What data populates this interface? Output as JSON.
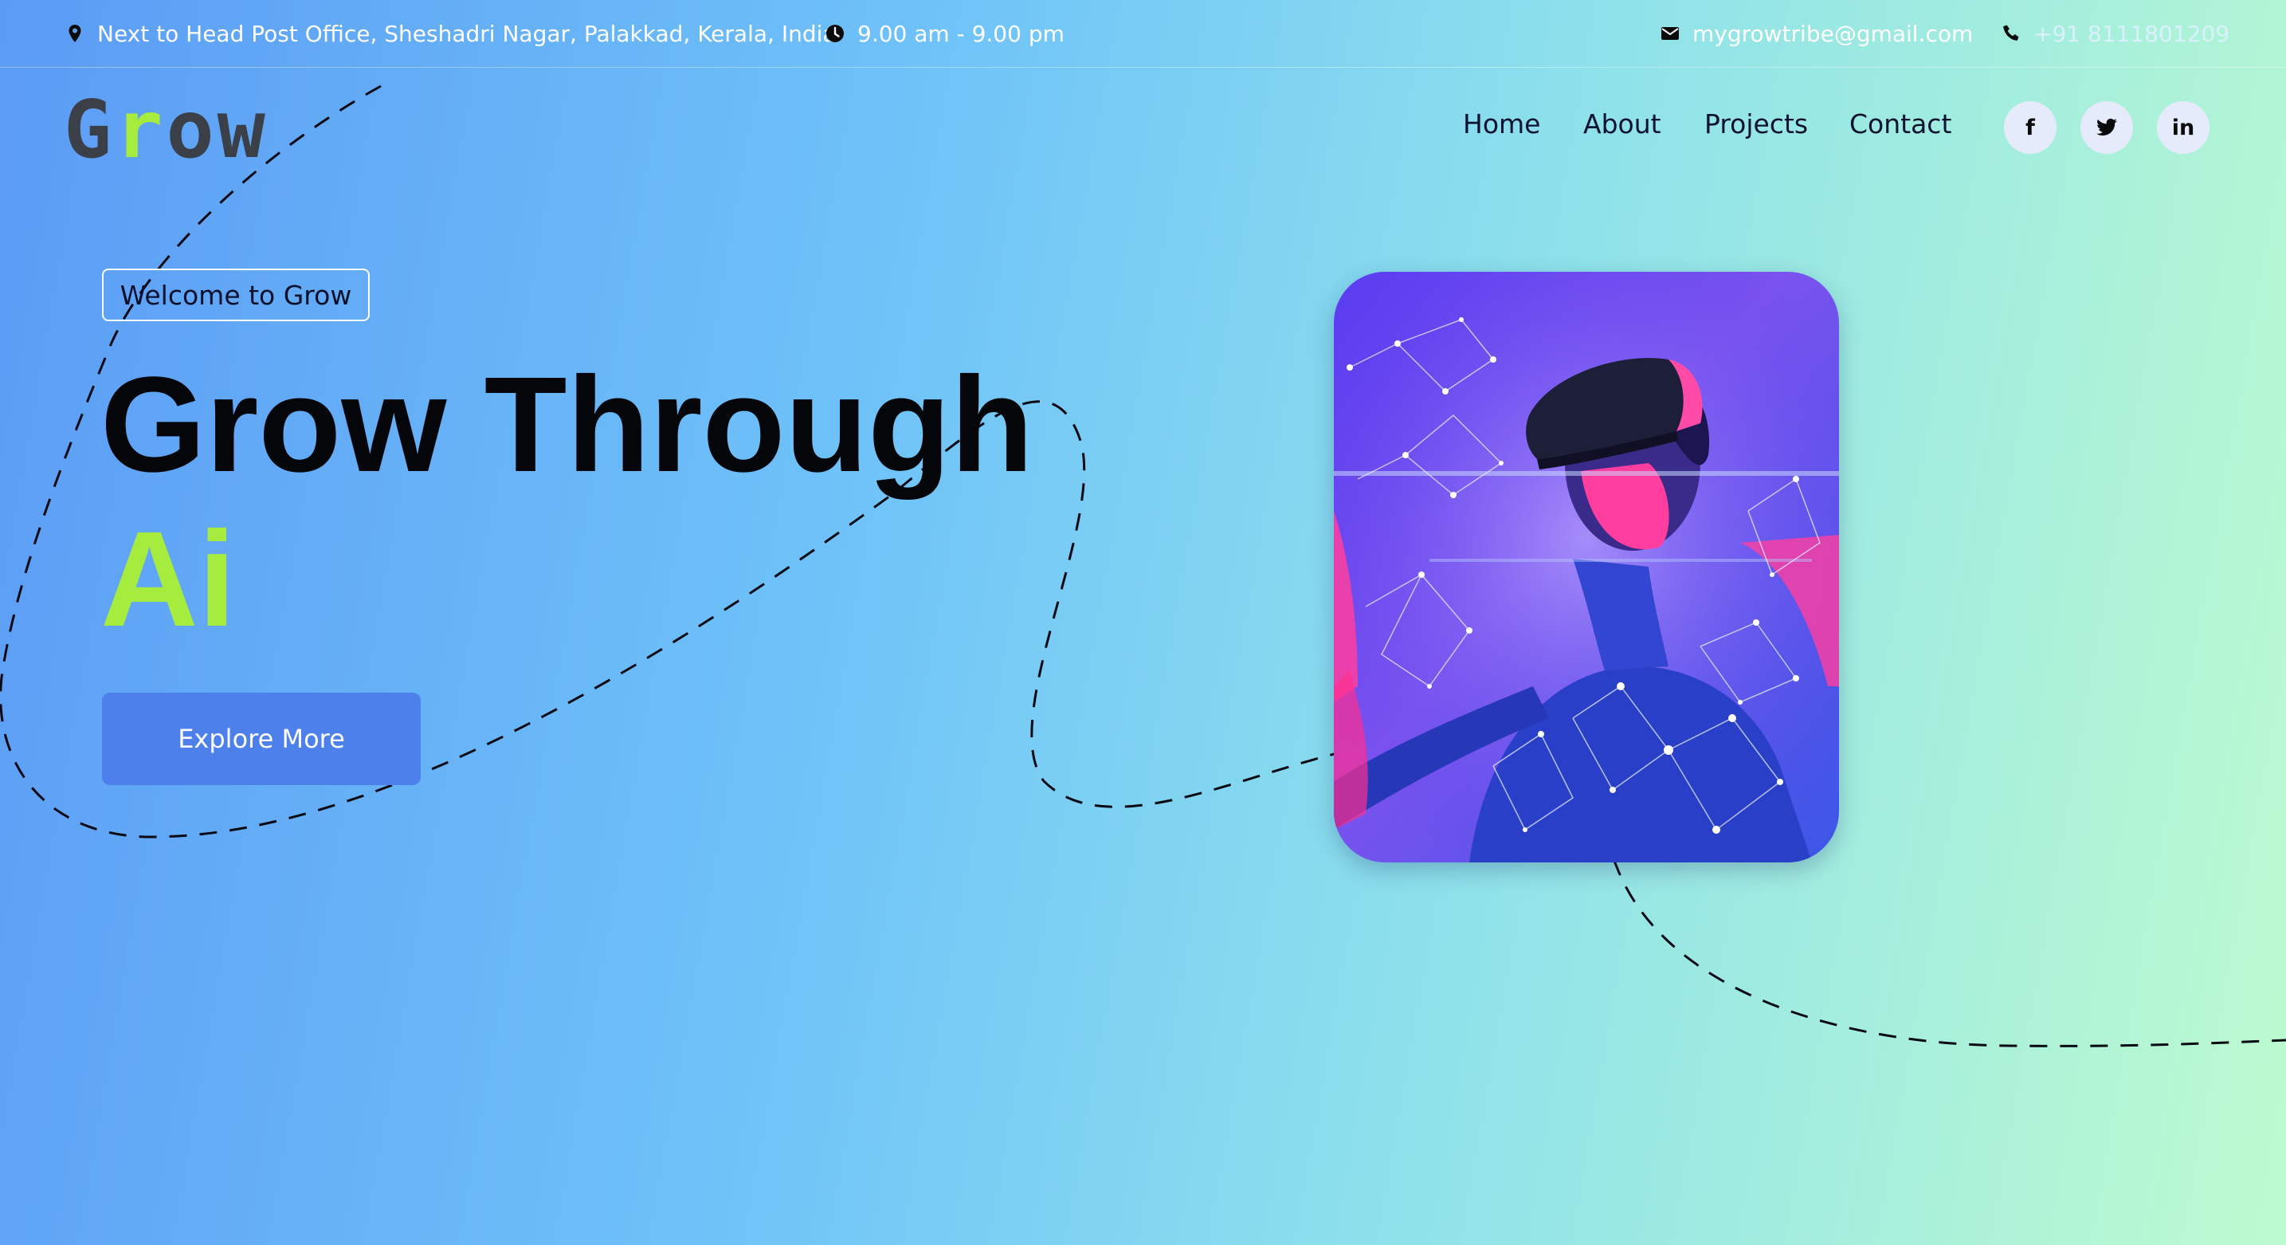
{
  "topbar": {
    "address": "Next to Head Post Office, Sheshadri Nagar, Palakkad, Kerala, India",
    "address_icon": "location-pin-icon",
    "hours": "9.00 am - 9.00 pm",
    "hours_icon": "clock-icon",
    "email": "mygrowtribe@gmail.com",
    "email_icon": "envelope-icon",
    "phone": "+91 8111801209",
    "phone_icon": "phone-icon"
  },
  "header": {
    "logo_text": "Grow",
    "logo_accent_color": "#a6ec3e",
    "nav": [
      {
        "label": "Home"
      },
      {
        "label": "About"
      },
      {
        "label": "Projects"
      },
      {
        "label": "Contact"
      }
    ],
    "social": [
      {
        "name": "facebook-icon",
        "glyph": "f"
      },
      {
        "name": "twitter-icon"
      },
      {
        "name": "linkedin-icon",
        "glyph": "in"
      }
    ]
  },
  "hero": {
    "tagline": "Welcome to Grow",
    "headline": "Grow Through",
    "headline_accent": "Ai",
    "cta_label": "Explore More",
    "accent_color": "#a6ec3e",
    "button_color": "#4d80ea"
  }
}
